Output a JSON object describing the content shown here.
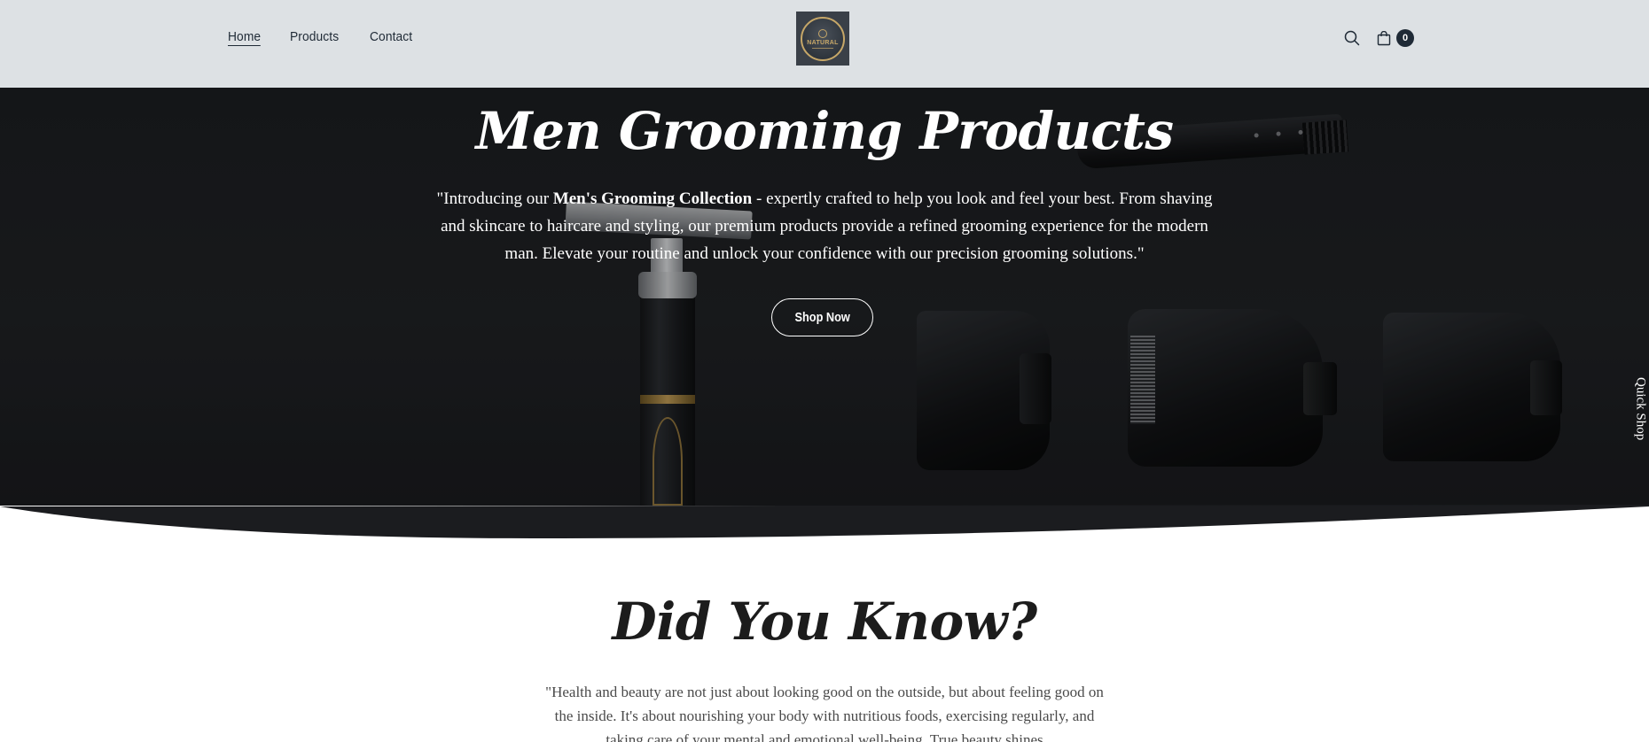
{
  "header": {
    "nav": [
      {
        "label": "Home",
        "active": true
      },
      {
        "label": "Products",
        "active": false
      },
      {
        "label": "Contact",
        "active": false
      }
    ],
    "logo": {
      "text": "NATURAL"
    },
    "cart_count": "0",
    "icons": {
      "search": "search-icon",
      "cart": "cart-icon"
    }
  },
  "hero": {
    "title": "Men Grooming Products",
    "intro_pre": "\"Introducing our ",
    "intro_bold": "Men's Grooming Collection",
    "intro_post": " - expertly crafted to help you look and feel your best. From shaving and skincare to haircare and styling, our premium products provide a refined grooming experience for the modern man. Elevate your routine and unlock your confidence with our precision grooming solutions.\"",
    "button_label": "Shop Now"
  },
  "quick_shop_label": "Quick Shop",
  "did_you_know": {
    "title": "Did You Know?",
    "text": "\"Health and beauty are not just about looking good on the outside, but about feeling good on the inside. It's about nourishing your body with nutritious foods, exercising regularly, and taking care of your mental and emotional well-being. True beauty shines"
  },
  "colors": {
    "header_bg": "#dde1e4",
    "nav_text": "#1f2a36",
    "hero_bg": "#1d1f22",
    "accent_gold": "#c6a768"
  }
}
